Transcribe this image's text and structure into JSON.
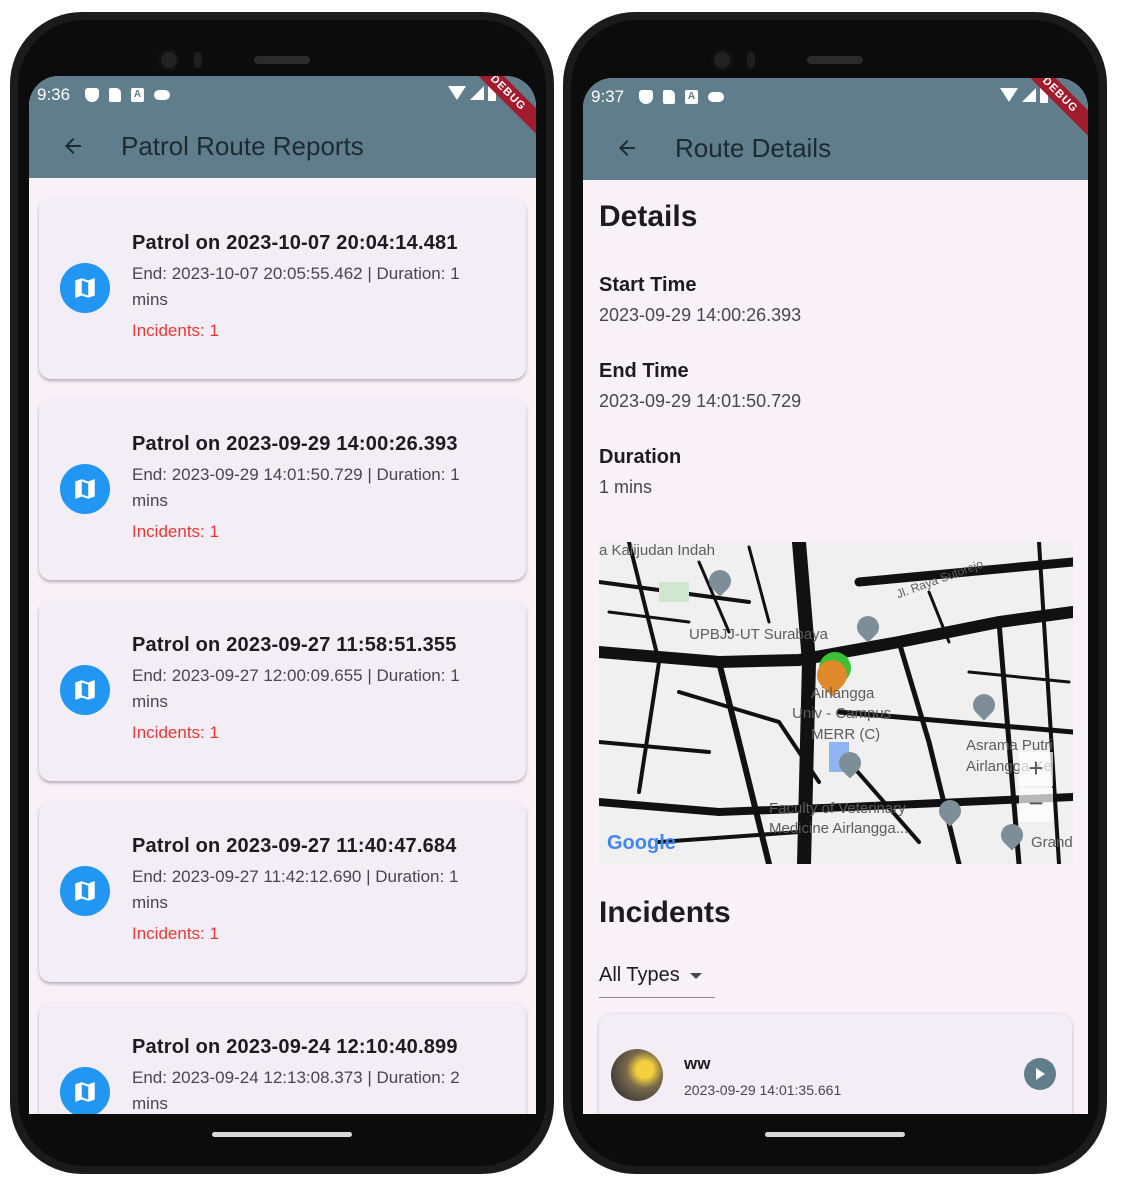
{
  "left_screen": {
    "status": {
      "time": "9:36",
      "debug": "DEBUG"
    },
    "title": "Patrol Route Reports",
    "reports": [
      {
        "title": "Patrol on 2023-10-07 20:04:14.481",
        "sub": "End: 2023-10-07 20:05:55.462 | Duration: 1 mins",
        "incidents": "Incidents: 1"
      },
      {
        "title": "Patrol on 2023-09-29 14:00:26.393",
        "sub": "End: 2023-09-29 14:01:50.729 | Duration: 1 mins",
        "incidents": "Incidents: 1"
      },
      {
        "title": "Patrol on 2023-09-27 11:58:51.355",
        "sub": "End: 2023-09-27 12:00:09.655 | Duration: 1 mins",
        "incidents": "Incidents: 1"
      },
      {
        "title": "Patrol on 2023-09-27 11:40:47.684",
        "sub": "End: 2023-09-27 11:42:12.690 | Duration: 1 mins",
        "incidents": "Incidents: 1"
      },
      {
        "title": "Patrol on 2023-09-24 12:10:40.899",
        "sub": "End: 2023-09-24 12:13:08.373 | Duration: 2 mins",
        "incidents": ""
      }
    ]
  },
  "right_screen": {
    "status": {
      "time": "9:37",
      "debug": "DEBUG"
    },
    "title": "Route Details",
    "details_heading": "Details",
    "start_label": "Start Time",
    "start_value": "2023-09-29 14:00:26.393",
    "end_label": "End Time",
    "end_value": "2023-09-29 14:01:50.729",
    "duration_label": "Duration",
    "duration_value": "1 mins",
    "map": {
      "labels": {
        "kalijudan": "a Kalijudan Indah",
        "sutorejo": "Jl. Raya Sutorejo",
        "upbjj": "UPBJJ-UT Surabaya",
        "airlangga1": "Airlangga",
        "airlangga2": "Univ - Campus",
        "airlangga3": "MERR (C)",
        "asrama1": "Asrama Putri",
        "asrama2": "Airlangga Ke",
        "faculty1": "Faculty of Veterinary",
        "faculty2": "Medicine Airlangga...",
        "grand": "Grand",
        "google": "Google"
      }
    },
    "incidents_heading": "Incidents",
    "filter_value": "All Types",
    "incident": {
      "title": "ww",
      "time": "2023-09-29 14:01:35.661"
    }
  }
}
